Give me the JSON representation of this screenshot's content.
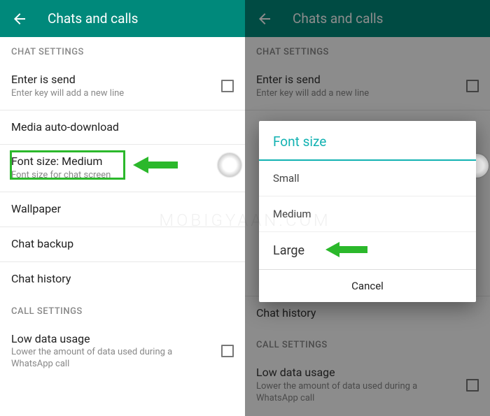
{
  "left": {
    "header": {
      "title": "Chats and calls"
    },
    "section_chat": "CHAT SETTINGS",
    "items": {
      "enter_send": {
        "title": "Enter is send",
        "sub": "Enter key will add a new line"
      },
      "media": {
        "title": "Media auto-download"
      },
      "font_size": {
        "title": "Font size: Medium",
        "sub": "Font size for chat screen"
      },
      "wallpaper": {
        "title": "Wallpaper"
      },
      "chat_backup": {
        "title": "Chat backup"
      },
      "chat_history": {
        "title": "Chat history"
      }
    },
    "section_call": "CALL SETTINGS",
    "low_data": {
      "title": "Low data usage",
      "sub": "Lower the amount of data used during a WhatsApp call"
    }
  },
  "right": {
    "header": {
      "title": "Chats and calls"
    },
    "section_chat": "CHAT SETTINGS",
    "items": {
      "enter_send": {
        "title": "Enter is send",
        "sub": "Enter key will add a new line"
      },
      "chat_history": {
        "title": "Chat history"
      }
    },
    "section_call": "CALL SETTINGS",
    "low_data": {
      "title": "Low data usage",
      "sub": "Lower the amount of data used during a WhatsApp call"
    },
    "dialog": {
      "title": "Font size",
      "options": {
        "small": "Small",
        "medium": "Medium",
        "large": "Large"
      },
      "cancel": "Cancel"
    }
  },
  "watermark": "MOBIGYAAN.COM"
}
